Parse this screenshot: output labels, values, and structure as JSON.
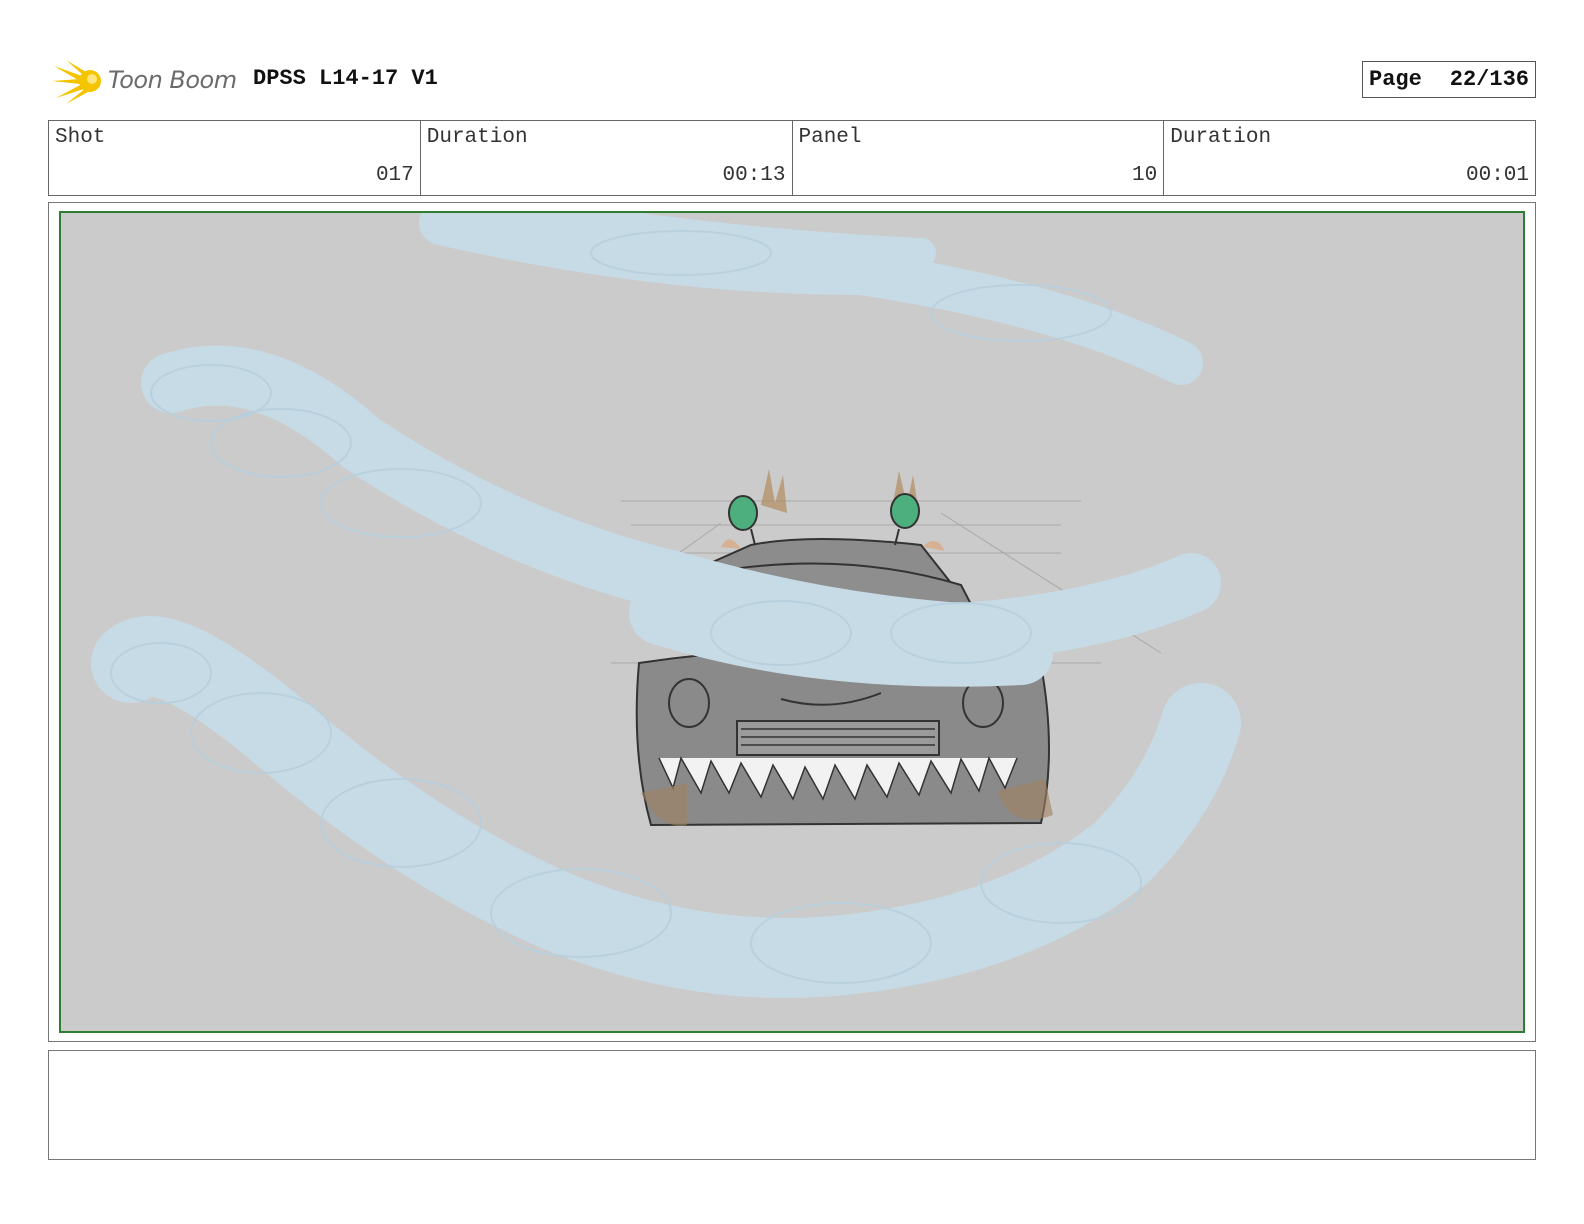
{
  "header": {
    "logo_text": "Toon Boom",
    "project_title": "DPSS L14-17 V1",
    "page_label": "Page",
    "page_value": "22/136"
  },
  "info": [
    {
      "label": "Shot",
      "value": "017"
    },
    {
      "label": "Duration",
      "value": "00:13"
    },
    {
      "label": "Panel",
      "value": "10"
    },
    {
      "label": "Duration",
      "value": "00:01"
    }
  ],
  "notes": {
    "text": ""
  },
  "colors": {
    "panel_border": "#2e7d32",
    "sky": "#cbcbcb",
    "smoke": "#c7dbe6",
    "car": "#8c8c8c",
    "headlight": "#4caf7d",
    "logo": "#f5c400"
  },
  "icons": [
    "toon-boom-logo-icon"
  ]
}
